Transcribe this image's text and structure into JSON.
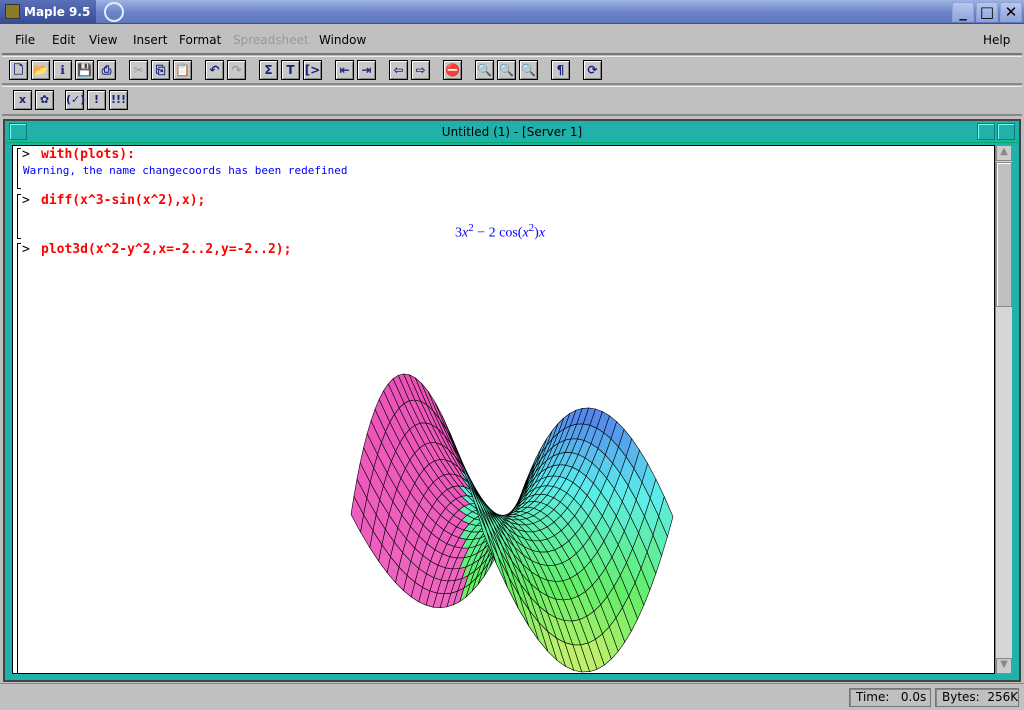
{
  "window": {
    "title": "Maple 9.5",
    "minimize": "_",
    "maximize": "□",
    "close": "✕"
  },
  "menu": [
    {
      "label": "File"
    },
    {
      "label": "Edit"
    },
    {
      "label": "View"
    },
    {
      "label": "Insert"
    },
    {
      "label": "Format"
    },
    {
      "label": "Spreadsheet",
      "disabled": true
    },
    {
      "label": "Window"
    },
    {
      "label": "Help"
    }
  ],
  "toolbar1": [
    {
      "name": "new-icon",
      "g": "🗋"
    },
    {
      "name": "open-icon",
      "g": "📂"
    },
    {
      "name": "open-url-icon",
      "g": "ℹ"
    },
    {
      "name": "save-icon",
      "g": "💾"
    },
    {
      "name": "print-icon",
      "g": "⎙"
    },
    {
      "name": "cut-icon",
      "g": "✂",
      "dis": true
    },
    {
      "name": "copy-icon",
      "g": "⎘"
    },
    {
      "name": "paste-icon",
      "g": "📋",
      "dis": true
    },
    {
      "name": "undo-icon",
      "g": "↶"
    },
    {
      "name": "redo-icon",
      "g": "↷",
      "dis": true
    },
    {
      "name": "sum-icon",
      "g": "Σ"
    },
    {
      "name": "text-icon",
      "g": "T"
    },
    {
      "name": "prompt-icon",
      "g": "[>"
    },
    {
      "name": "outdent-icon",
      "g": "⇤"
    },
    {
      "name": "indent-icon",
      "g": "⇥"
    },
    {
      "name": "back-icon",
      "g": "⇦"
    },
    {
      "name": "forward-icon",
      "g": "⇨"
    },
    {
      "name": "stop-icon",
      "g": "⛔"
    },
    {
      "name": "zoom-small-icon",
      "g": "🔍"
    },
    {
      "name": "zoom-medium-icon",
      "g": "🔍"
    },
    {
      "name": "zoom-large-icon",
      "g": "🔍"
    },
    {
      "name": "pilcrow-icon",
      "g": "¶"
    },
    {
      "name": "restart-icon",
      "g": "⟳"
    }
  ],
  "toolbar2": [
    {
      "name": "text-mode-icon",
      "g": "x"
    },
    {
      "name": "maple-input-icon",
      "g": "✿"
    },
    {
      "name": "execute-check-icon",
      "g": "(✓)"
    },
    {
      "name": "execute-icon",
      "g": "!"
    },
    {
      "name": "execute-all-icon",
      "g": "!!!"
    }
  ],
  "document": {
    "title": "Untitled (1) - [Server 1]",
    "prompt": ">",
    "cmd1": "with(plots):",
    "warning": "Warning, the name changecoords has been redefined",
    "cmd2": "diff(x^3-sin(x^2),x);",
    "out2": {
      "a": "3",
      "x": "x",
      "e": "2",
      "b": " − 2 cos(",
      "x2": "x",
      "e2": "2",
      "c": ")",
      "x3": "x"
    },
    "cmd3": "plot3d(x^2-y^2,x=-2..2,y=-2..2);"
  },
  "chart_data": {
    "type": "surface3d",
    "function": "x^2-y^2",
    "x_range": [
      -2,
      2
    ],
    "y_range": [
      -2,
      2
    ],
    "grid": [
      25,
      25
    ],
    "shading": "xyz"
  },
  "status": {
    "time_label": "Time:",
    "time": "0.0s",
    "bytes_label": "Bytes:",
    "bytes": "256K"
  }
}
